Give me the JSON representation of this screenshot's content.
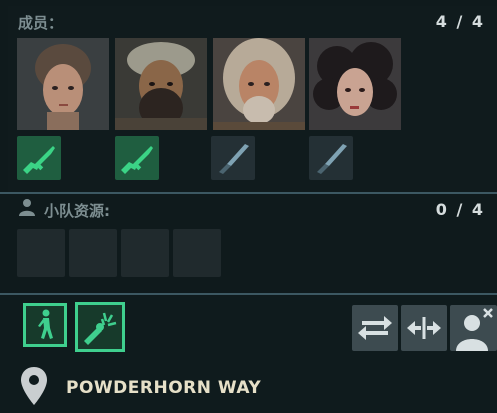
{
  "members": {
    "label": "成员：",
    "count": "4 / 4",
    "portraits": [
      {
        "icon": "female-soldier-portrait"
      },
      {
        "icon": "bearded-man-portrait"
      },
      {
        "icon": "old-long-hair-man-portrait"
      },
      {
        "icon": "curly-hair-woman-portrait"
      }
    ],
    "weapons": [
      {
        "type": "rifle",
        "icon": "rifle-icon"
      },
      {
        "type": "rifle",
        "icon": "rifle-icon"
      },
      {
        "type": "knife",
        "icon": "knife-icon"
      },
      {
        "type": "knife",
        "icon": "knife-icon"
      }
    ]
  },
  "squad_resources": {
    "label": "小队资源:",
    "count": "0 / 4",
    "slots": 4
  },
  "actions": {
    "walk_icon": "walk-icon",
    "attack_icon": "melee-attack-icon",
    "swap_icon": "swap-arrows-icon",
    "split_icon": "split-arrows-icon",
    "remove_member_icon": "remove-person-icon"
  },
  "location": {
    "icon": "map-pin-icon",
    "name": "POWDERHORN WAY"
  },
  "colors": {
    "accent_green": "#3fcf8e",
    "rifle_bg": "#1f5e40",
    "knife_bg": "#243035",
    "divider": "#3c5862"
  }
}
